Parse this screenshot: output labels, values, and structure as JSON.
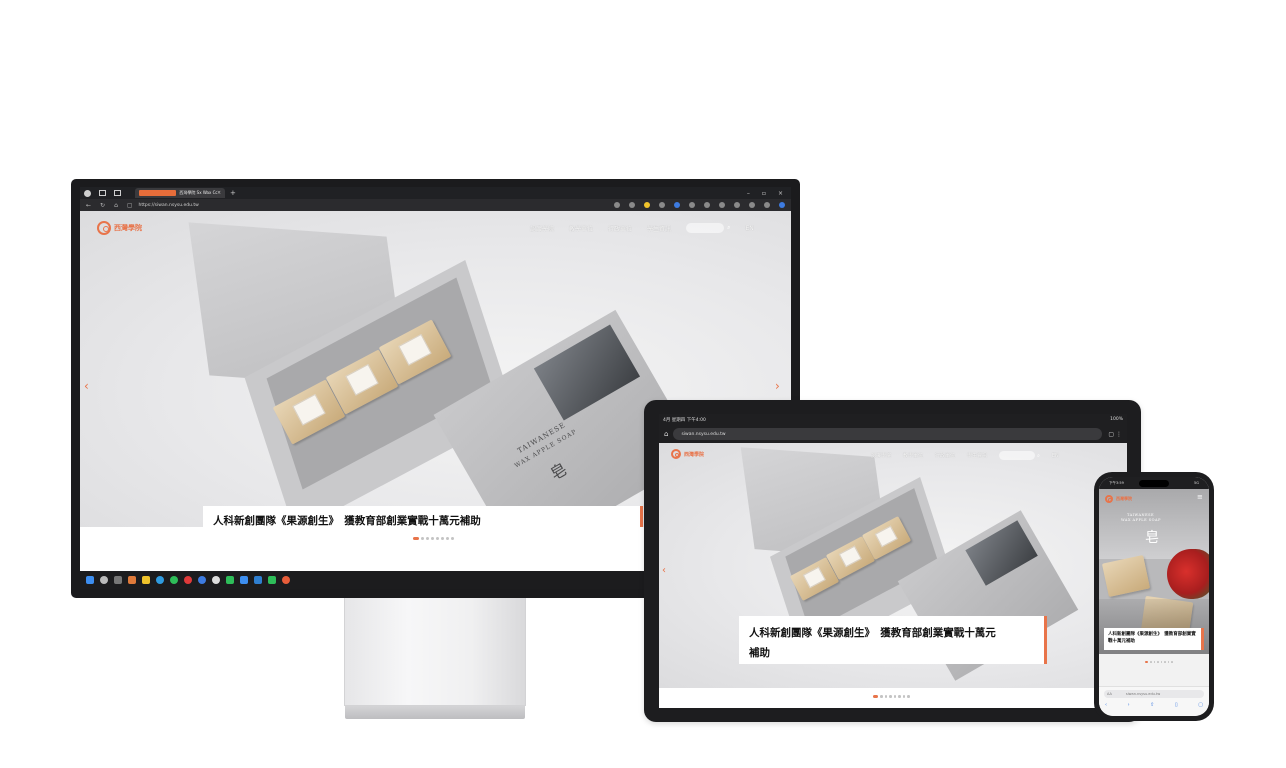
{
  "browser": {
    "tab_title": "西灣學院 Sx Wax College | 國立",
    "tab_close": "×",
    "new_tab": "+",
    "window_controls": [
      "–",
      "▫",
      "×"
    ],
    "url": "https://siwan.nsysu.edu.tw"
  },
  "site": {
    "logo_text": "西灣學院",
    "nav": [
      "認識學院",
      "教學單位",
      "行政單位",
      "學生資訊"
    ],
    "lang": "EN",
    "caption": "人科新創團隊《果源創生》　獲教育部創業實戰十萬元補助",
    "sleeve_text_1": "TAIWANESE",
    "sleeve_text_2": "WAX APPLE SOAP",
    "sleeve_char": "皂",
    "prev_arrow": "‹",
    "next_arrow": "›",
    "slide_count": 8,
    "active_slide": 1
  },
  "tablet": {
    "status_left": "4月 星期四 下午4:00",
    "status_right": "100%",
    "url": "siwan.nsysu.edu.tw",
    "caption_line1": "人科新創團隊《果源創生》　獲教育部創業實戰十萬元",
    "caption_line2": "補助"
  },
  "phone": {
    "status_time": "下午3:59",
    "status_right": "5G",
    "menu_icon": "≡",
    "caption": "人科新創團隊《果源創生》　獲教育部創業實戰十萬元補助",
    "aa_label": "AA",
    "url": "siwan.nsysu.edu.tw"
  },
  "colors": {
    "accent": "#e8744a",
    "frame": "#1d1d1f"
  }
}
